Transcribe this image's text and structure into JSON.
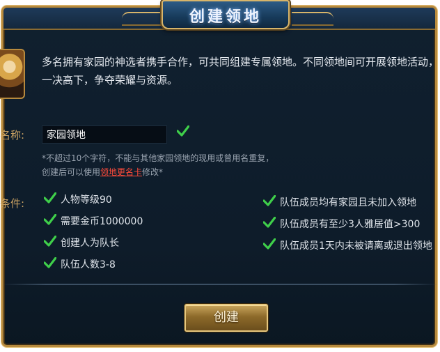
{
  "title": "创建领地",
  "intro": "多名拥有家园的神选者携手合作，可共同组建专属领地。不同领地间可开展领地活动，一决高下，争夺荣耀与资源。",
  "name_label": "名称:",
  "name_input": {
    "value": "家园领地"
  },
  "hint_line1": "*不超过10个字符，不能与其他家园领地的现用或曾用名重复，",
  "hint_line2_prefix": "创建后可以使用",
  "hint_link": "领地更名卡",
  "hint_line2_suffix": "修改*",
  "conditions_label": "条件:",
  "conditions_left": [
    "人物等级90",
    "需要金币1000000",
    "创建人为队长",
    "队伍人数3-8"
  ],
  "conditions_right": [
    "队伍成员均有家园且未加入领地",
    "队伍成员有至少3人雅居值>300",
    "队伍成员1天内未被请离或退出领地"
  ],
  "create_button": "创建",
  "colors": {
    "gold": "#c7a062",
    "check": "#3fcf4a",
    "link": "#ff4b3a",
    "panel": "#10202f"
  }
}
